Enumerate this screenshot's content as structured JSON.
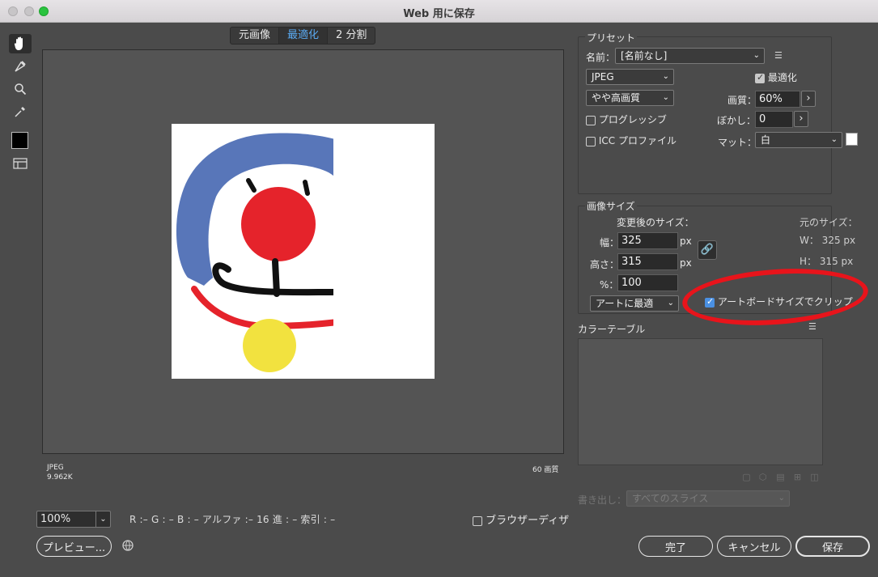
{
  "window": {
    "title": "Web 用に保存"
  },
  "tabs": [
    {
      "label": "元画像"
    },
    {
      "label": "最適化"
    },
    {
      "label": "2 分割"
    }
  ],
  "preview": {
    "format": "JPEG",
    "file_size": "9.962K",
    "quality_note": "60 画質"
  },
  "bottom": {
    "zoom": "100%",
    "pixel_info": "R :– G : – B : – アルファ :– 16 進 : – 索引 : –",
    "browser_dither_label": "ブラウザーディザ",
    "preview_button": "プレビュー...",
    "done_button": "完了",
    "cancel_button": "キャンセル",
    "save_button": "保存"
  },
  "preset": {
    "section_label": "プリセット",
    "name_label": "名前：",
    "name_value": "[名前なし]",
    "format_value": "JPEG",
    "optimize_label": "最適化",
    "quality_preset": "やや高画質",
    "quality_label": "画質：",
    "quality_value": "60%",
    "progressive_label": "プログレッシブ",
    "blur_label": "ぼかし：",
    "blur_value": "0",
    "icc_label": "ICC プロファイル",
    "matte_label": "マット：",
    "matte_value": "白"
  },
  "image_size": {
    "section_label": "画像サイズ",
    "new_size_label": "変更後のサイズ：",
    "width_label": "幅：",
    "width_value": "325",
    "height_label": "高さ：",
    "height_value": "315",
    "percent_label": "%：",
    "percent_value": "100",
    "unit": "px",
    "unit2": "px",
    "original_label": "元のサイズ：",
    "original_w": "W： 325 px",
    "original_h": "H： 315 px",
    "resample_value": "アートに最適",
    "clip_label": "アートボードサイズでクリップ"
  },
  "color_table": {
    "section_label": "カラーテーブル"
  },
  "export": {
    "label": "書き出し：",
    "value": "すべてのスライス"
  },
  "colors": {
    "accent": "#5aa9f0",
    "highlight_ring": "#e8141b"
  }
}
